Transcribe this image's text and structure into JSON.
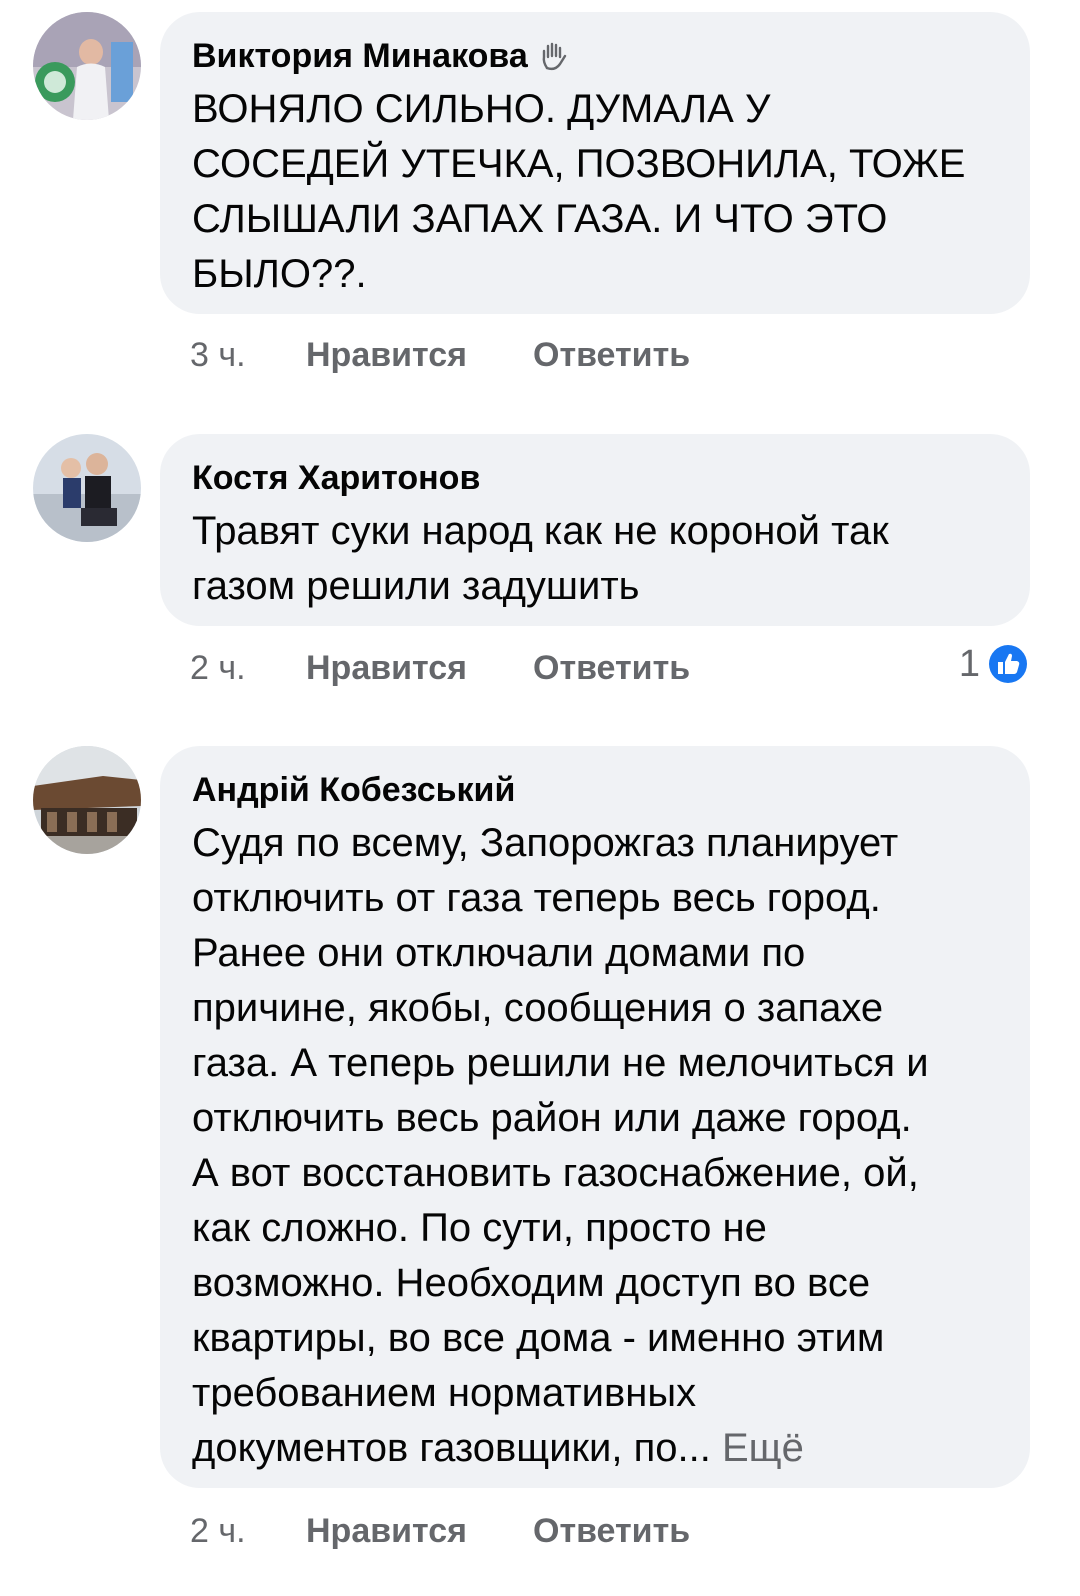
{
  "comments": [
    {
      "author": "Виктория Минакова",
      "badge_icon": "waving-hand-icon",
      "text_lines": [
        "ВОНЯЛО СИЛЬНО. ДУМАЛА У",
        "СОСЕДЕЙ УТЕЧКА, ПОЗВОНИЛА, ТОЖЕ",
        "СЛЫШАЛИ ЗАПАХ ГАЗА. И ЧТО ЭТО",
        "БЫЛО??."
      ],
      "time": "3 ч.",
      "like_label": "Нравится",
      "reply_label": "Ответить"
    },
    {
      "author": "Костя Харитонов",
      "text_lines": [
        "Травят суки народ как не короной так",
        "газом решили задушить"
      ],
      "time": "2 ч.",
      "like_label": "Нравится",
      "reply_label": "Ответить",
      "reaction_count": "1",
      "reaction_icon": "thumbs-up-icon"
    },
    {
      "author": "Андрій Кобезський",
      "text_lines": [
        "Судя по всему, Запорожгаз планирует",
        "отключить от газа теперь весь город.",
        "Ранее они отключали домами по",
        "причине, якобы, сообщения о запахе",
        "газа. А теперь решили не мелочиться и",
        "отключить весь район или даже город.",
        "А вот восстановить газоснабжение, ой,",
        "как сложно. По сути, просто не",
        "возможно. Необходим доступ во все",
        "квартиры, во все дома - именно этим",
        "требованием нормативных"
      ],
      "last_line": "документов газовщики, по...",
      "more_label": "Ещё",
      "time": "2 ч.",
      "like_label": "Нравится",
      "reply_label": "Ответить"
    }
  ],
  "colors": {
    "bubble": "#f0f2f5",
    "text": "#050505",
    "secondary": "#65676b",
    "like_blue": "#1877f2"
  }
}
